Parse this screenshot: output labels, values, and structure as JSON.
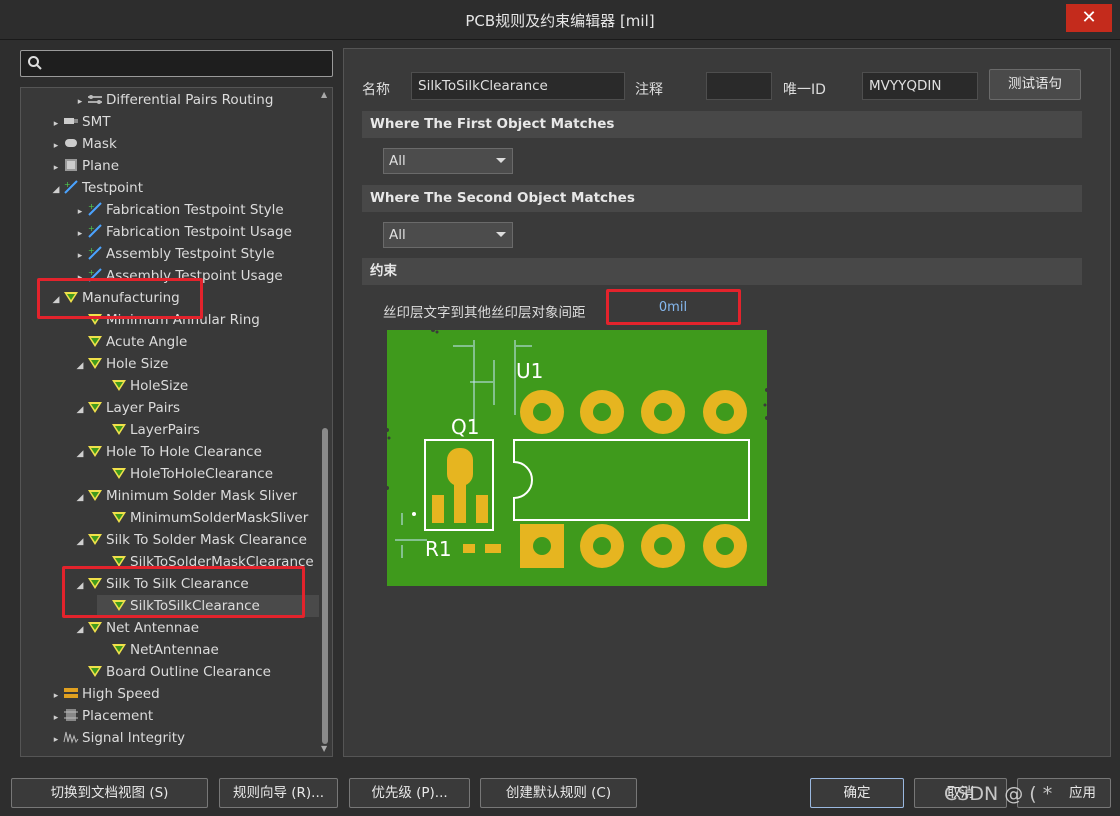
{
  "window": {
    "title": "PCB规则及约束编辑器 [mil]",
    "close": "✕"
  },
  "tree": {
    "items": [
      {
        "label": "Differential Pairs Routing",
        "expander": "▸"
      },
      {
        "label": "SMT",
        "expander": "▸"
      },
      {
        "label": "Mask",
        "expander": "▸"
      },
      {
        "label": "Plane",
        "expander": "▸"
      },
      {
        "label": "Testpoint",
        "expander": "◢"
      },
      {
        "label": "Fabrication Testpoint Style",
        "expander": "▸"
      },
      {
        "label": "Fabrication Testpoint Usage",
        "expander": "▸"
      },
      {
        "label": "Assembly Testpoint Style",
        "expander": "▸"
      },
      {
        "label": "Assembly Testpoint Usage",
        "expander": "▸"
      },
      {
        "label": "Manufacturing",
        "expander": "◢"
      },
      {
        "label": "Minimum Annular Ring",
        "expander": ""
      },
      {
        "label": "Acute Angle",
        "expander": ""
      },
      {
        "label": "Hole Size",
        "expander": "◢"
      },
      {
        "label": "HoleSize",
        "expander": ""
      },
      {
        "label": "Layer Pairs",
        "expander": "◢"
      },
      {
        "label": "LayerPairs",
        "expander": ""
      },
      {
        "label": "Hole To Hole Clearance",
        "expander": "◢"
      },
      {
        "label": "HoleToHoleClearance",
        "expander": ""
      },
      {
        "label": "Minimum Solder Mask Sliver",
        "expander": "◢"
      },
      {
        "label": "MinimumSolderMaskSliver",
        "expander": ""
      },
      {
        "label": "Silk To Solder Mask Clearance",
        "expander": "◢"
      },
      {
        "label": "SilkToSolderMaskClearance",
        "expander": ""
      },
      {
        "label": "Silk To Silk Clearance",
        "expander": "◢"
      },
      {
        "label": "SilkToSilkClearance",
        "expander": ""
      },
      {
        "label": "Net Antennae",
        "expander": "◢"
      },
      {
        "label": "NetAntennae",
        "expander": ""
      },
      {
        "label": "Board Outline Clearance",
        "expander": ""
      },
      {
        "label": "High Speed",
        "expander": "▸"
      },
      {
        "label": "Placement",
        "expander": "▸"
      },
      {
        "label": "Signal Integrity",
        "expander": "▸"
      }
    ]
  },
  "rule": {
    "name_label": "名称",
    "name_value": "SilkToSilkClearance",
    "comment_label": "注释",
    "comment_value": "",
    "uid_label": "唯一ID",
    "uid_value": "MVYYQDIN",
    "test_button": "测试语句"
  },
  "first_match": {
    "header": "Where The First Object Matches",
    "value": "All"
  },
  "second_match": {
    "header": "Where The Second Object Matches",
    "value": "All"
  },
  "constraints": {
    "header": "约束",
    "label": "丝印层文字到其他丝印层对象间距",
    "value": "0mil"
  },
  "pcb": {
    "u1": "U1",
    "q1": "Q1",
    "r1": "R1"
  },
  "buttons": {
    "doc_view": "切换到文档视图 (S)",
    "wizard": "规则向导 (R)...",
    "priority": "优先级 (P)...",
    "create_default": "创建默认规则 (C)",
    "ok": "确定",
    "cancel": "取消",
    "apply": "应用"
  },
  "watermark": "CSDN @ ( *",
  "colors": {
    "pcb_green": "#3f9a1c",
    "pad_gold": "#e6b520",
    "highlight_red": "#e3232c",
    "value_blue": "#86b9f0"
  }
}
